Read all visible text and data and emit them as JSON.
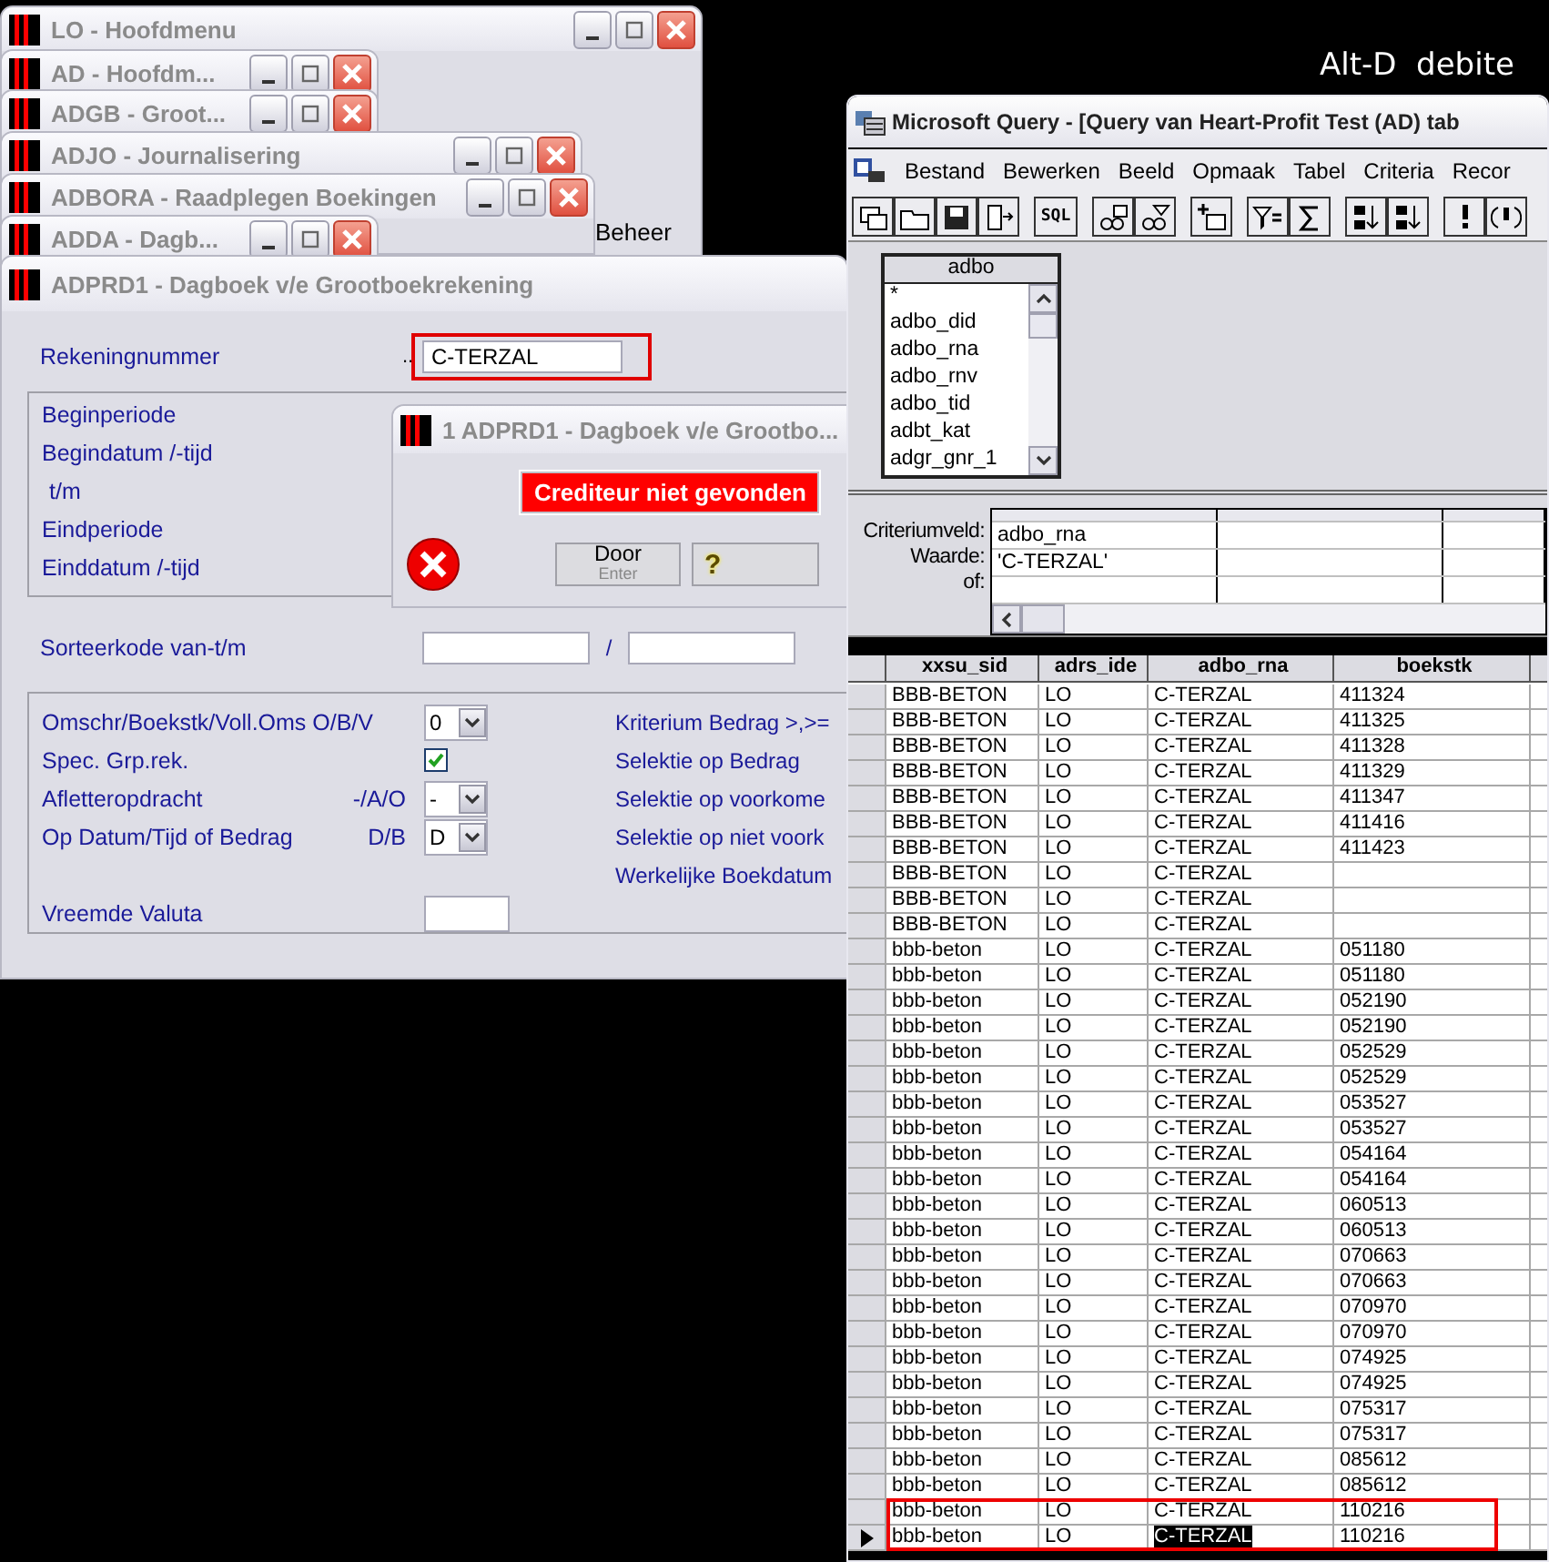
{
  "banner": {
    "text": "Alt-D  debite"
  },
  "background_windows": [
    {
      "title": "LO - Hoofdmenu",
      "body_text": "Beheer"
    },
    {
      "title": "AD - Hoofdm..."
    },
    {
      "title": "ADGB - Groot..."
    },
    {
      "title": "ADJO - Journalisering"
    },
    {
      "title": "ADBORA - Raadplegen Boekingen"
    },
    {
      "title": "ADDA - Dagb..."
    }
  ],
  "form_window": {
    "title": "ADPRD1 - Dagboek v/e Grootboekrekening",
    "account": {
      "label": "Rekeningnummer",
      "lookup": "..",
      "value": "C-TERZAL",
      "highlighted": true
    },
    "period_labels": [
      "Beginperiode",
      "Begindatum /-tijd",
      "t/m",
      "Eindperiode",
      "Einddatum /-tijd"
    ],
    "sort_code": {
      "label": "Sorteerkode van-t/m",
      "separator": "/"
    },
    "options": [
      {
        "kind": "select",
        "label": "Omschr/Boekstk/Voll.Oms O/B/V",
        "value": "0"
      },
      {
        "kind": "checkbox",
        "label": "Spec. Grp.rek.",
        "checked": true
      },
      {
        "kind": "select",
        "label": "Afletteropdracht",
        "hint": "-/A/O",
        "value": "-"
      },
      {
        "kind": "select",
        "label": "Op Datum/Tijd of Bedrag",
        "hint": "D/B",
        "value": "D"
      },
      {
        "kind": "blank"
      },
      {
        "kind": "input",
        "label": "Vreemde Valuta"
      }
    ],
    "right_labels": [
      "Kriterium Bedrag >,>=",
      "Selektie op Bedrag",
      "Selektie op voorkome",
      "Selektie op niet voork",
      "Werkelijke Boekdatum"
    ]
  },
  "error_dialog": {
    "title": "1 ADPRD1 - Dagboek v/e Grootbo...",
    "message": "Crediteur niet gevonden",
    "ok_button": {
      "label": "Door",
      "hint": "Enter"
    },
    "help_button": {
      "label": "?"
    }
  },
  "query_window": {
    "title": "Microsoft Query - [Query van Heart-Profit Test (AD) tab",
    "menus": [
      "Bestand",
      "Bewerken",
      "Beeld",
      "Opmaak",
      "Tabel",
      "Criteria",
      "Recor"
    ],
    "toolbar": {
      "sql_label": "SQL"
    },
    "field_list": {
      "table": "adbo",
      "fields": [
        "*",
        "adbo_did",
        "adbo_rna",
        "adbo_rnv",
        "adbo_tid",
        "adbt_kat",
        "adgr_gnr_1"
      ]
    },
    "criteria": {
      "rows": [
        {
          "label": "Criteriumveld:",
          "value": "adbo_rna"
        },
        {
          "label": "Waarde:",
          "value": "'C-TERZAL'"
        },
        {
          "label": "of:"
        }
      ]
    },
    "table": {
      "columns": [
        "xxsu_sid",
        "adrs_ide",
        "adbo_rna",
        "boekstk"
      ],
      "rows": [
        {
          "cells": [
            "BBB-BETON",
            "LO",
            "C-TERZAL",
            "411324"
          ],
          "current": false,
          "highlighted": false,
          "cell_selected": [
            false,
            false,
            false,
            false
          ]
        },
        {
          "cells": [
            "BBB-BETON",
            "LO",
            "C-TERZAL",
            "411325"
          ],
          "current": false,
          "highlighted": false,
          "cell_selected": [
            false,
            false,
            false,
            false
          ]
        },
        {
          "cells": [
            "BBB-BETON",
            "LO",
            "C-TERZAL",
            "411328"
          ],
          "current": false,
          "highlighted": false,
          "cell_selected": [
            false,
            false,
            false,
            false
          ]
        },
        {
          "cells": [
            "BBB-BETON",
            "LO",
            "C-TERZAL",
            "411329"
          ],
          "current": false,
          "highlighted": false,
          "cell_selected": [
            false,
            false,
            false,
            false
          ]
        },
        {
          "cells": [
            "BBB-BETON",
            "LO",
            "C-TERZAL",
            "411347"
          ],
          "current": false,
          "highlighted": false,
          "cell_selected": [
            false,
            false,
            false,
            false
          ]
        },
        {
          "cells": [
            "BBB-BETON",
            "LO",
            "C-TERZAL",
            "411416"
          ],
          "current": false,
          "highlighted": false,
          "cell_selected": [
            false,
            false,
            false,
            false
          ]
        },
        {
          "cells": [
            "BBB-BETON",
            "LO",
            "C-TERZAL",
            "411423"
          ],
          "current": false,
          "highlighted": false,
          "cell_selected": [
            false,
            false,
            false,
            false
          ]
        },
        {
          "cells": [
            "BBB-BETON",
            "LO",
            "C-TERZAL"
          ],
          "current": false,
          "highlighted": false,
          "cell_selected": [
            false,
            false,
            false,
            false
          ]
        },
        {
          "cells": [
            "BBB-BETON",
            "LO",
            "C-TERZAL"
          ],
          "current": false,
          "highlighted": false,
          "cell_selected": [
            false,
            false,
            false,
            false
          ]
        },
        {
          "cells": [
            "BBB-BETON",
            "LO",
            "C-TERZAL"
          ],
          "current": false,
          "highlighted": false,
          "cell_selected": [
            false,
            false,
            false,
            false
          ]
        },
        {
          "cells": [
            "bbb-beton",
            "LO",
            "C-TERZAL",
            "051180"
          ],
          "current": false,
          "highlighted": false,
          "cell_selected": [
            false,
            false,
            false,
            false
          ]
        },
        {
          "cells": [
            "bbb-beton",
            "LO",
            "C-TERZAL",
            "051180"
          ],
          "current": false,
          "highlighted": false,
          "cell_selected": [
            false,
            false,
            false,
            false
          ]
        },
        {
          "cells": [
            "bbb-beton",
            "LO",
            "C-TERZAL",
            "052190"
          ],
          "current": false,
          "highlighted": false,
          "cell_selected": [
            false,
            false,
            false,
            false
          ]
        },
        {
          "cells": [
            "bbb-beton",
            "LO",
            "C-TERZAL",
            "052190"
          ],
          "current": false,
          "highlighted": false,
          "cell_selected": [
            false,
            false,
            false,
            false
          ]
        },
        {
          "cells": [
            "bbb-beton",
            "LO",
            "C-TERZAL",
            "052529"
          ],
          "current": false,
          "highlighted": false,
          "cell_selected": [
            false,
            false,
            false,
            false
          ]
        },
        {
          "cells": [
            "bbb-beton",
            "LO",
            "C-TERZAL",
            "052529"
          ],
          "current": false,
          "highlighted": false,
          "cell_selected": [
            false,
            false,
            false,
            false
          ]
        },
        {
          "cells": [
            "bbb-beton",
            "LO",
            "C-TERZAL",
            "053527"
          ],
          "current": false,
          "highlighted": false,
          "cell_selected": [
            false,
            false,
            false,
            false
          ]
        },
        {
          "cells": [
            "bbb-beton",
            "LO",
            "C-TERZAL",
            "053527"
          ],
          "current": false,
          "highlighted": false,
          "cell_selected": [
            false,
            false,
            false,
            false
          ]
        },
        {
          "cells": [
            "bbb-beton",
            "LO",
            "C-TERZAL",
            "054164"
          ],
          "current": false,
          "highlighted": false,
          "cell_selected": [
            false,
            false,
            false,
            false
          ]
        },
        {
          "cells": [
            "bbb-beton",
            "LO",
            "C-TERZAL",
            "054164"
          ],
          "current": false,
          "highlighted": false,
          "cell_selected": [
            false,
            false,
            false,
            false
          ]
        },
        {
          "cells": [
            "bbb-beton",
            "LO",
            "C-TERZAL",
            "060513"
          ],
          "current": false,
          "highlighted": false,
          "cell_selected": [
            false,
            false,
            false,
            false
          ]
        },
        {
          "cells": [
            "bbb-beton",
            "LO",
            "C-TERZAL",
            "060513"
          ],
          "current": false,
          "highlighted": false,
          "cell_selected": [
            false,
            false,
            false,
            false
          ]
        },
        {
          "cells": [
            "bbb-beton",
            "LO",
            "C-TERZAL",
            "070663"
          ],
          "current": false,
          "highlighted": false,
          "cell_selected": [
            false,
            false,
            false,
            false
          ]
        },
        {
          "cells": [
            "bbb-beton",
            "LO",
            "C-TERZAL",
            "070663"
          ],
          "current": false,
          "highlighted": false,
          "cell_selected": [
            false,
            false,
            false,
            false
          ]
        },
        {
          "cells": [
            "bbb-beton",
            "LO",
            "C-TERZAL",
            "070970"
          ],
          "current": false,
          "highlighted": false,
          "cell_selected": [
            false,
            false,
            false,
            false
          ]
        },
        {
          "cells": [
            "bbb-beton",
            "LO",
            "C-TERZAL",
            "070970"
          ],
          "current": false,
          "highlighted": false,
          "cell_selected": [
            false,
            false,
            false,
            false
          ]
        },
        {
          "cells": [
            "bbb-beton",
            "LO",
            "C-TERZAL",
            "074925"
          ],
          "current": false,
          "highlighted": false,
          "cell_selected": [
            false,
            false,
            false,
            false
          ]
        },
        {
          "cells": [
            "bbb-beton",
            "LO",
            "C-TERZAL",
            "074925"
          ],
          "current": false,
          "highlighted": false,
          "cell_selected": [
            false,
            false,
            false,
            false
          ]
        },
        {
          "cells": [
            "bbb-beton",
            "LO",
            "C-TERZAL",
            "075317"
          ],
          "current": false,
          "highlighted": false,
          "cell_selected": [
            false,
            false,
            false,
            false
          ]
        },
        {
          "cells": [
            "bbb-beton",
            "LO",
            "C-TERZAL",
            "075317"
          ],
          "current": false,
          "highlighted": false,
          "cell_selected": [
            false,
            false,
            false,
            false
          ]
        },
        {
          "cells": [
            "bbb-beton",
            "LO",
            "C-TERZAL",
            "085612"
          ],
          "current": false,
          "highlighted": false,
          "cell_selected": [
            false,
            false,
            false,
            false
          ]
        },
        {
          "cells": [
            "bbb-beton",
            "LO",
            "C-TERZAL",
            "085612"
          ],
          "current": false,
          "highlighted": false,
          "cell_selected": [
            false,
            false,
            false,
            false
          ]
        },
        {
          "cells": [
            "bbb-beton",
            "LO",
            "C-TERZAL",
            "110216"
          ],
          "current": false,
          "highlighted": true,
          "cell_selected": [
            false,
            false,
            false,
            false
          ]
        },
        {
          "cells": [
            "bbb-beton",
            "LO",
            "C-TERZAL",
            "110216"
          ],
          "current": true,
          "highlighted": true,
          "cell_selected": [
            false,
            false,
            true,
            false
          ]
        }
      ]
    }
  }
}
